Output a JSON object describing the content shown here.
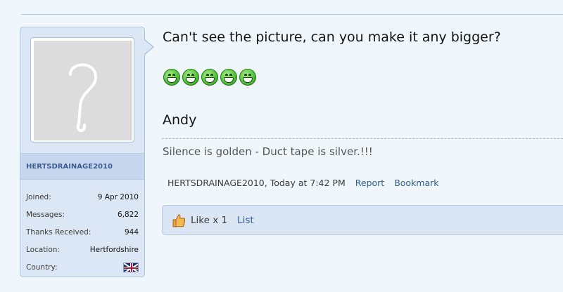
{
  "post": {
    "message": "Can't see the picture, can you make it any bigger?",
    "smilies": [
      "grin-icon",
      "grin-icon",
      "grin-icon",
      "grin-icon",
      "grin-icon"
    ],
    "signoff": "Andy",
    "signature": "Silence is golden - Duct tape is silver.!!!"
  },
  "user": {
    "name": "HERTSDRAINAGE2010",
    "avatar_glyph": "?",
    "joined_label": "Joined:",
    "joined_value": "9 Apr 2010",
    "messages_label": "Messages:",
    "messages_value": "6,822",
    "thanks_label": "Thanks Received:",
    "thanks_value": "944",
    "location_label": "Location:",
    "location_value": "Hertfordshire",
    "country_label": "Country:",
    "country_flag": "uk-flag-icon"
  },
  "meta": {
    "author": "HERTSDRAINAGE2010",
    "time": ", Today at 7:42 PM",
    "report": "Report",
    "bookmark": "Bookmark"
  },
  "likes": {
    "text": "Like x 1",
    "list": "List"
  },
  "colors": {
    "page_bg": "#f0f7fc",
    "sidebar_bg": "#dce7f5",
    "link": "#2b5c9e",
    "username": "#3a5d96"
  }
}
